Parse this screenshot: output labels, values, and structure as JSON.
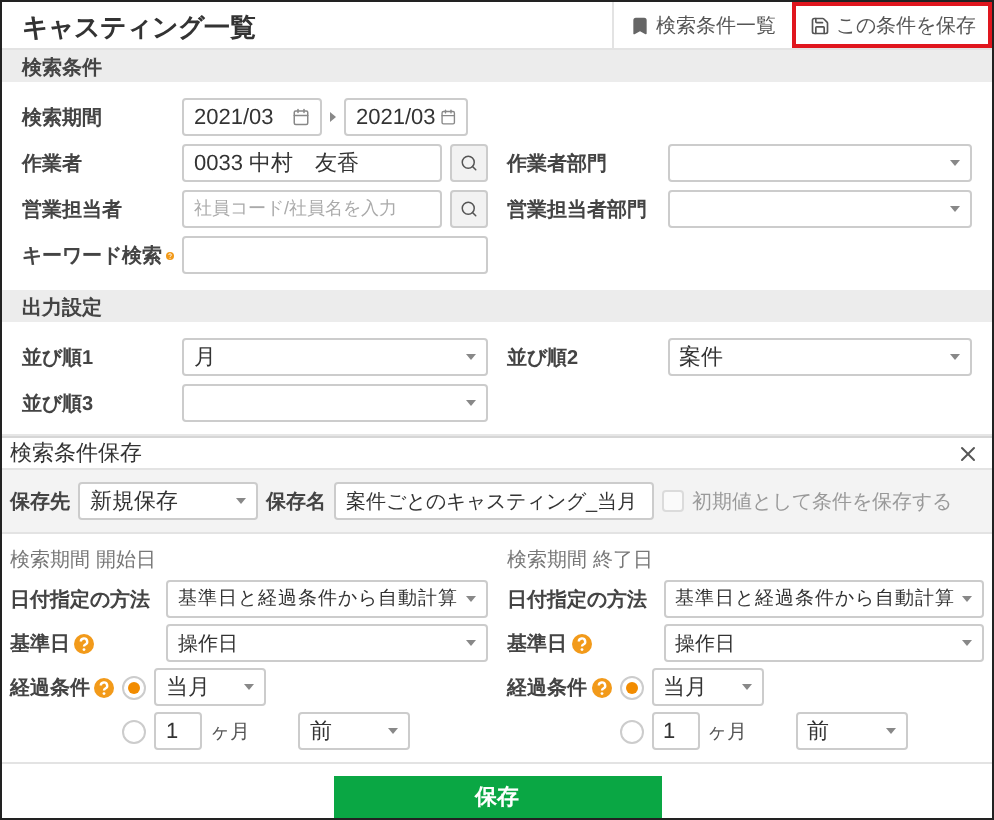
{
  "page": {
    "title": "キャスティング一覧",
    "actions": [
      {
        "kind": "list",
        "label": "検索条件一覧",
        "highlighted": false
      },
      {
        "kind": "save",
        "label": "この条件を保存",
        "highlighted": true
      }
    ]
  },
  "search": {
    "title": "検索条件",
    "period": {
      "label": "検索期間",
      "from": "2021/03",
      "to": "2021/03"
    },
    "worker": {
      "label": "作業者",
      "value": "0033 中村　友香"
    },
    "worker_dept": {
      "label": "作業者部門"
    },
    "sales": {
      "label": "営業担当者",
      "placeholder": "社員コード/社員名を入力"
    },
    "sales_dept": {
      "label": "営業担当者部門"
    },
    "keyword": {
      "label": "キーワード検索"
    }
  },
  "output": {
    "title": "出力設定",
    "sorts": [
      {
        "label": "並び順1",
        "value": "月"
      },
      {
        "label": "並び順2",
        "value": "案件"
      },
      {
        "label": "並び順3"
      }
    ]
  },
  "dialog": {
    "title": "検索条件保存",
    "target": {
      "label": "保存先",
      "value": "新規保存"
    },
    "name": {
      "label": "保存名",
      "value": "案件ごとのキャスティング_当月"
    },
    "default": {
      "label": "初期値として条件を保存する",
      "checked": false,
      "disabled": true
    },
    "ranges": [
      {
        "heading": "検索期間 開始日",
        "method": {
          "label": "日付指定の方法",
          "value": "基準日と経過条件から自動計算"
        },
        "base": {
          "label": "基準日",
          "value": "操作日"
        },
        "elapsed": {
          "label": "経過条件",
          "options": [
            {
              "kind": "preset",
              "selected": true,
              "value": "当月"
            },
            {
              "kind": "offset",
              "selected": false,
              "count": "1",
              "unit": "ヶ月",
              "direction": "前"
            }
          ]
        }
      },
      {
        "heading": "検索期間 終了日",
        "method": {
          "label": "日付指定の方法",
          "value": "基準日と経過条件から自動計算"
        },
        "base": {
          "label": "基準日",
          "value": "操作日"
        },
        "elapsed": {
          "label": "経過条件",
          "options": [
            {
              "kind": "preset",
              "selected": true,
              "value": "当月"
            },
            {
              "kind": "offset",
              "selected": false,
              "count": "1",
              "unit": "ヶ月",
              "direction": "前"
            }
          ]
        }
      }
    ],
    "submit": "保存"
  }
}
